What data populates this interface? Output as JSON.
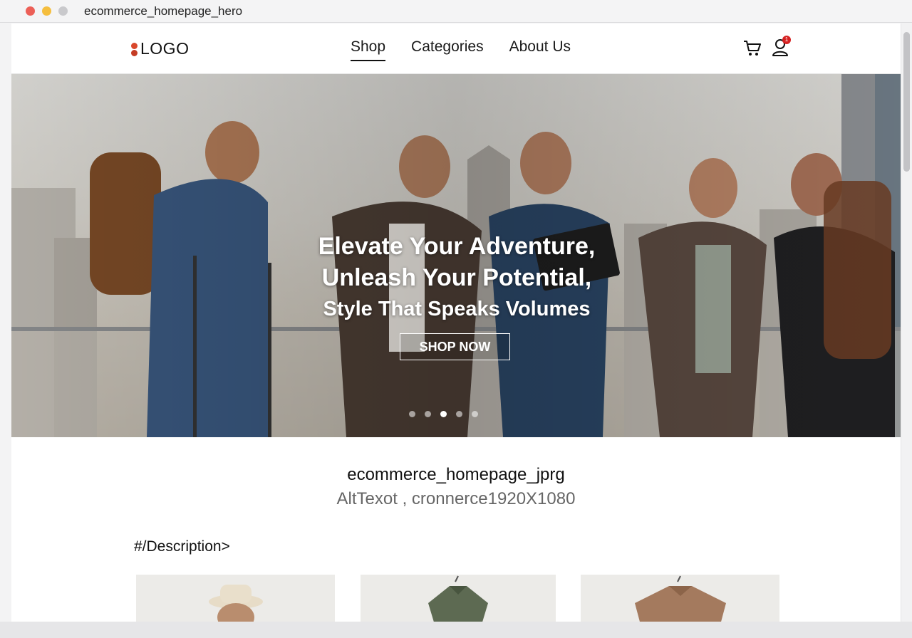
{
  "window": {
    "title": "ecommerce_homepage_hero"
  },
  "header": {
    "logo": "LOGO",
    "nav": [
      {
        "label": "Shop",
        "active": true
      },
      {
        "label": "Categories",
        "active": false
      },
      {
        "label": "About Us",
        "active": false
      }
    ],
    "user_badge_count": "1"
  },
  "hero": {
    "line1": "Elevate Your Adventure,",
    "line2": "Unleash Your Potential,",
    "line3": "Style That Speaks Volumes",
    "cta": "SHOP NOW",
    "carousel_count": 5,
    "carousel_active": 2
  },
  "caption": {
    "title": "ecommerce_homepage_jprg",
    "subtitle": "AltTexot , cronnerce1920X1080"
  },
  "description_heading": "#/Description>",
  "products": [
    {
      "icon": "hat-icon"
    },
    {
      "icon": "green-shirt-icon"
    },
    {
      "icon": "brown-shirt-icon"
    }
  ],
  "colors": {
    "accent": "#d9472b",
    "badge": "#d62222"
  }
}
